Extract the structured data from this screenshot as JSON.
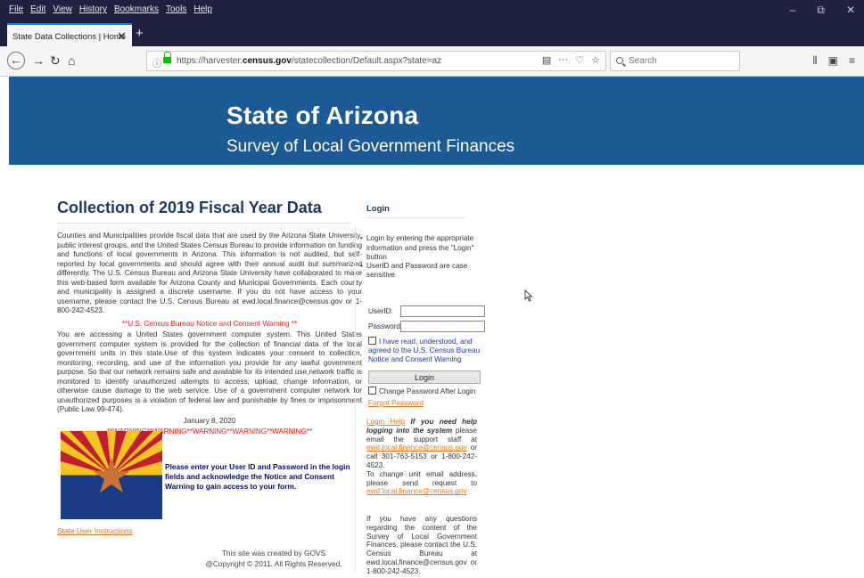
{
  "browser": {
    "menu": [
      "File",
      "Edit",
      "View",
      "History",
      "Bookmarks",
      "Tools",
      "Help"
    ],
    "window_controls": [
      "–",
      "⧉",
      "✕"
    ],
    "tab": {
      "title": "State Data Collections | Home",
      "close": "✕"
    },
    "new_tab": "+",
    "nav": {
      "back": "←",
      "forward": "→",
      "reload": "↻",
      "home": "⌂"
    },
    "url": {
      "prefix": "https://harvester.",
      "domain": "census.gov",
      "path": "/statecollection/Default.aspx?state=az"
    },
    "url_actions": [
      "▤",
      "···",
      "♡",
      "☆"
    ],
    "search_placeholder": "Search",
    "toolbar_right": [
      "⫴",
      "▣",
      "≡"
    ]
  },
  "banner": {
    "title": "State of Arizona",
    "subtitle": "Survey of Local Government Finances"
  },
  "left": {
    "title": "Collection of 2019 Fiscal Year Data",
    "intro": "Counties and Municipalities provide fiscal data that are used by the Arizona State University, public interest groups, and the United States Census Bureau to provide information on funding and functions of local governments in Arizona. This information is not audited, but self-reported by local governments and should agree with their annual audit but summarized differently. The U.S. Census Bureau and Arizona State University have collaborated to make this web-based form available for Arizona County and Municipal Governments. Each county and municipality is assigned a discrete username. If you do not have access to your username, please contact the U.S. Census Bureau at ewd.local.finance@census.gov or 1-800-242-4523.",
    "notice_heading": "**U.S. Census Bureau Notice and Consent Warning **",
    "notice": "You are accessing a United States government computer system. This United States government computer system is provided for the collection of financial data of the local government units in this state.Use of this system indicates your consent to collection, monitoring, recording, and use of the information you provide for any lawful government purpose. So that our network remains safe and available for its intended use,network traffic is monitored to identify unauthorized attempts to access, upload, change information, or otherwise cause damage to the web service. Use of a government computer network for unauthorized purposes is a violation of federal law and punishable by fines or imprisonment (Public Law 99-474).",
    "date": "January 8, 2020",
    "warning": "**WARNING**WARNING**WARNING**WARNING**WARNING**",
    "flag_message": "Please enter your User ID and Password in the login fields and acknowledge the Notice and Consent Warning to gain access to your form.",
    "instructions_link": "State User Instructions",
    "footer_line1": "This site was created by GOVS",
    "footer_line2": "@Copyright © 2011. All Rights Reserved."
  },
  "login": {
    "title": "Login",
    "bullets": [
      "Login by entering the appropriate information and press the \"Login\" button",
      "UserID and Password are case sensitive"
    ],
    "userid_label": "UserID:",
    "password_label": "Password:",
    "agree_label": "I have read, understood, and agreed to the U.S. Census Bureau Notice and Consent Warning",
    "login_button": "Login",
    "change_password_label": "Change Password After Login",
    "forgot_link": "Forgot Password",
    "help_link": "Login Help",
    "help_em": "If you need help logging into the system",
    "help_text1": "please email the support staff at",
    "help_email": "ewd.local.finance@census.gov",
    "help_text2": "or call 301-763-5153 or 1-800-242-4523.",
    "help_text3": "To change unit email address, please send request to",
    "questions": "If you have any questions regarding the content of the Survey of Local Government Finances, please contact the U.S. Census Bureau at ewd.local.finance@census.gov or 1-800-242-4523."
  },
  "colors": {
    "banner": "#1b5a94",
    "title": "#1b3a5c",
    "warning_red": "#e0201c",
    "link_orange": "#e07b20",
    "flag_red": "#bf1f2e",
    "flag_gold": "#f3c422",
    "flag_blue": "#1b3b84",
    "flag_copper": "#c8733a"
  }
}
